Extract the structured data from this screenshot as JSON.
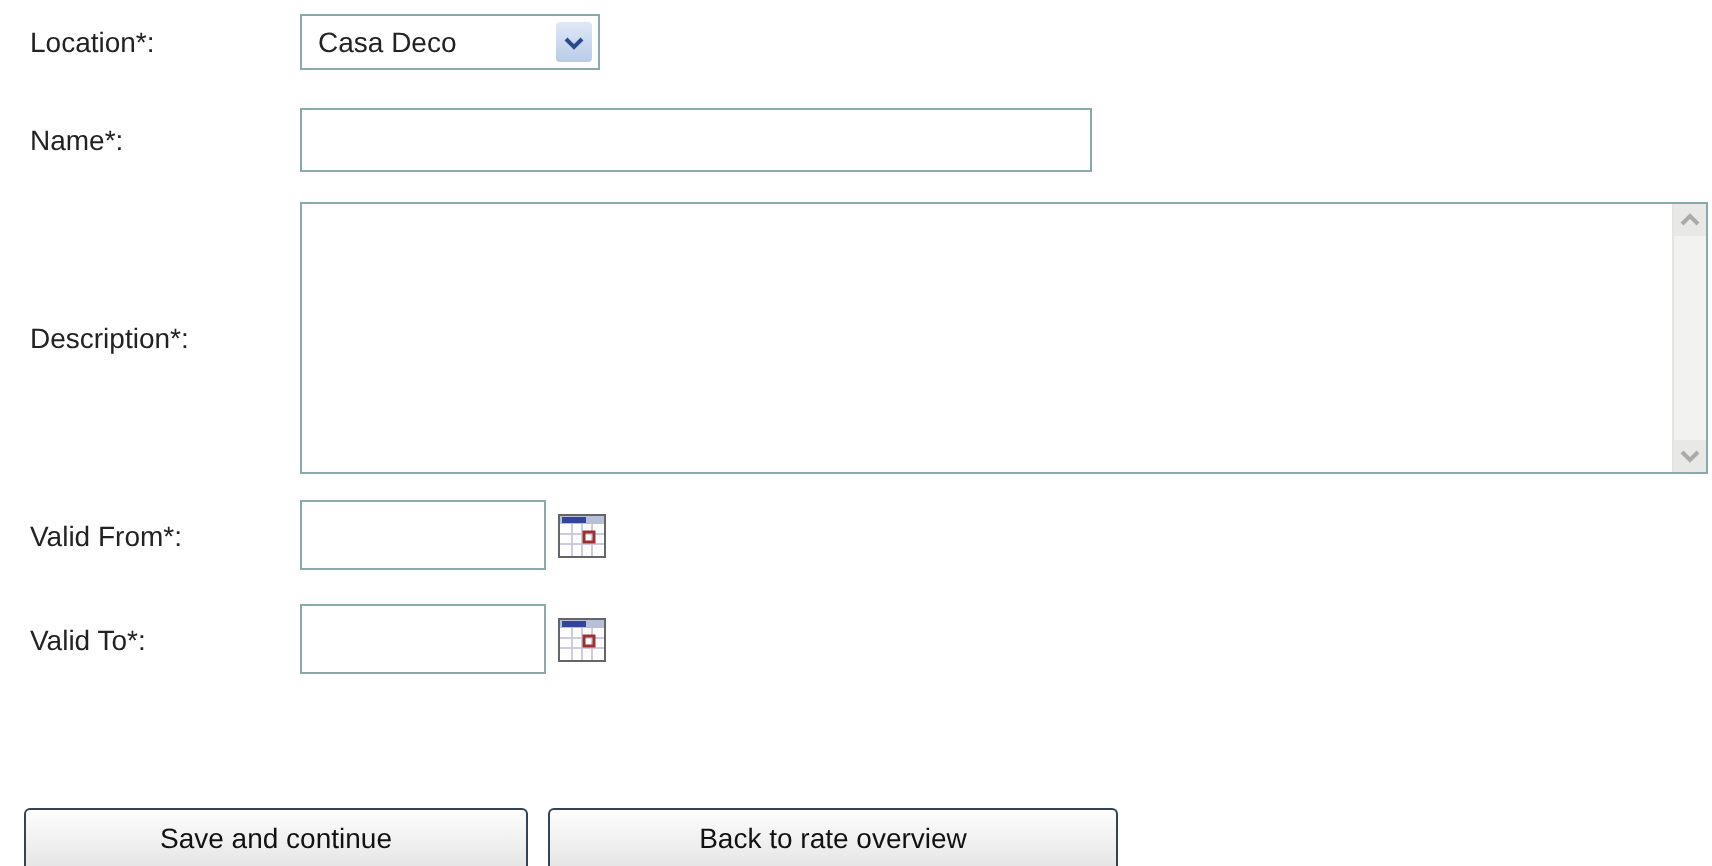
{
  "form": {
    "fields": [
      {
        "kind": "select",
        "label": "Location*:",
        "value": "Casa Deco"
      },
      {
        "kind": "text",
        "label": "Name*:"
      },
      {
        "kind": "textarea",
        "label": "Description*:"
      },
      {
        "kind": "date",
        "label": "Valid From*:"
      },
      {
        "kind": "date",
        "label": "Valid To*:"
      }
    ]
  },
  "buttons": [
    "Save and continue",
    "Back to rate overview"
  ]
}
